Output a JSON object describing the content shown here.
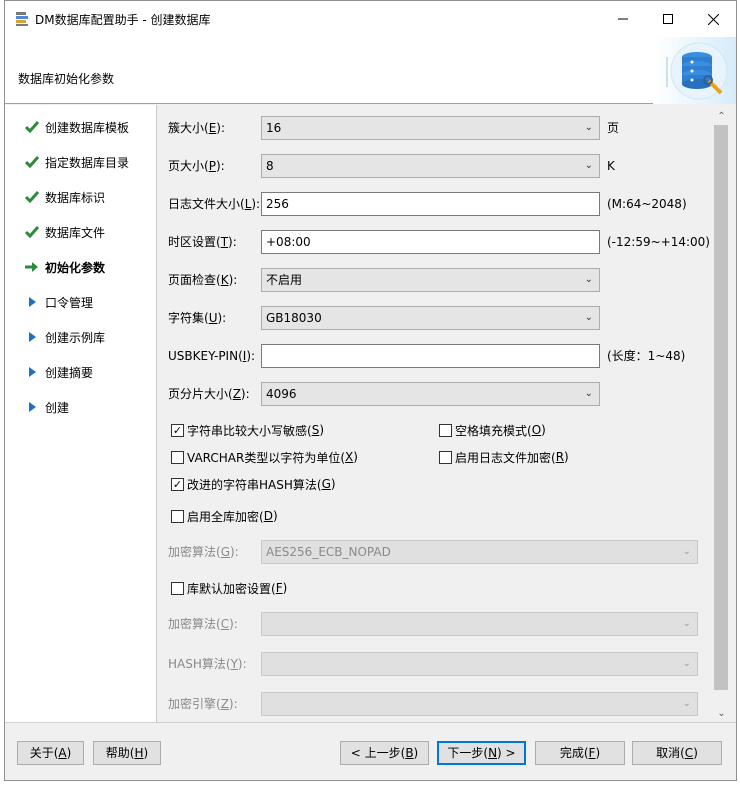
{
  "window": {
    "title": "DM数据库配置助手 - 创建数据库",
    "minimize": "—",
    "maximize": "☐",
    "close": "✕"
  },
  "header": {
    "title": "数据库初始化参数"
  },
  "nav": {
    "items": [
      {
        "label": "创建数据库模板",
        "state": "done"
      },
      {
        "label": "指定数据库目录",
        "state": "done"
      },
      {
        "label": "数据库标识",
        "state": "done"
      },
      {
        "label": "数据库文件",
        "state": "done"
      },
      {
        "label": "初始化参数",
        "state": "current"
      },
      {
        "label": "口令管理",
        "state": "pending"
      },
      {
        "label": "创建示例库",
        "state": "pending"
      },
      {
        "label": "创建摘要",
        "state": "pending"
      },
      {
        "label": "创建",
        "state": "pending"
      }
    ]
  },
  "form": {
    "extent_size": {
      "label": "簇大小(",
      "key": "E",
      "suffix": "):",
      "value": "16",
      "unit": "页"
    },
    "page_size": {
      "label": "页大小(",
      "key": "P",
      "suffix": "):",
      "value": "8",
      "unit": "K"
    },
    "log_size": {
      "label": "日志文件大小(",
      "key": "L",
      "suffix": "):",
      "value": "256",
      "unit": "(M:64~2048)"
    },
    "timezone": {
      "label": "时区设置(",
      "key": "T",
      "suffix": "):",
      "value": "+08:00",
      "unit": "(-12:59~+14:00)"
    },
    "page_check": {
      "label": "页面检查(",
      "key": "K",
      "suffix": "):",
      "value": "不启用"
    },
    "charset": {
      "label": "字符集(",
      "key": "U",
      "suffix": "):",
      "value": "GB18030"
    },
    "usbkey_pin": {
      "label": "USBKEY-PIN(",
      "key": "I",
      "suffix": "):",
      "value": "",
      "unit": "(长度：1~48)"
    },
    "page_shard": {
      "label": "页分片大小(",
      "key": "Z",
      "suffix": "):",
      "value": "4096"
    },
    "checks": {
      "case_sensitive": {
        "label": "字符串比较大小写敏感(",
        "key": "S",
        "suffix": ")",
        "checked": true
      },
      "blank_pad": {
        "label": "空格填充模式(",
        "key": "O",
        "suffix": ")",
        "checked": false
      },
      "varchar_char": {
        "label": "VARCHAR类型以字符为单位(",
        "key": "X",
        "suffix": ")",
        "checked": false
      },
      "log_encrypt": {
        "label": "启用日志文件加密(",
        "key": "R",
        "suffix": ")",
        "checked": false
      },
      "improved_hash": {
        "label": "改进的字符串HASH算法(",
        "key": "G",
        "suffix": ")",
        "checked": true
      },
      "full_encrypt": {
        "label": "启用全库加密(",
        "key": "D",
        "suffix": ")",
        "checked": false
      },
      "default_encrypt": {
        "label": "库默认加密设置(",
        "key": "F",
        "suffix": ")",
        "checked": false
      }
    },
    "encrypt_algo_1": {
      "label": "加密算法(",
      "key": "G",
      "suffix": "):",
      "value": "AES256_ECB_NOPAD"
    },
    "encrypt_algo_2": {
      "label": "加密算法(",
      "key": "C",
      "suffix": "):",
      "value": ""
    },
    "hash_algo": {
      "label": "HASH算法(",
      "key": "Y",
      "suffix": "):",
      "value": ""
    },
    "encrypt_engine": {
      "label": "加密引擎(",
      "key": "Z",
      "suffix": "):",
      "value": ""
    }
  },
  "footer": {
    "about": {
      "label": "关于(",
      "key": "A",
      "suffix": ")"
    },
    "help": {
      "label": "帮助(",
      "key": "H",
      "suffix": ")"
    },
    "back": {
      "label": "< 上一步(",
      "key": "B",
      "suffix": ")"
    },
    "next": {
      "label": "下一步(",
      "key": "N",
      "suffix": ") >"
    },
    "finish": {
      "label": "完成(",
      "key": "F",
      "suffix": ")"
    },
    "cancel": {
      "label": "取消(",
      "key": "C",
      "suffix": ")"
    }
  },
  "colors": {
    "accent": "#0078d7",
    "check_green": "#2e8b3d",
    "arrow_blue": "#1f6fc5"
  }
}
